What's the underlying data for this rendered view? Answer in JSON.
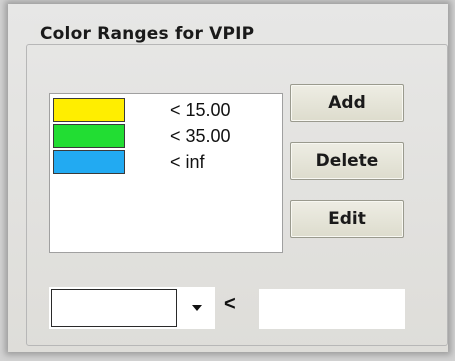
{
  "groupbox": {
    "title": "Color Ranges for VPIP"
  },
  "ranges": [
    {
      "color": "#ffee00",
      "label": "< 15.00"
    },
    {
      "color": "#22dd33",
      "label": "< 35.00"
    },
    {
      "color": "#22aaf2",
      "label": "< inf"
    }
  ],
  "buttons": {
    "add": "Add",
    "delete": "Delete",
    "edit": "Edit"
  },
  "editor": {
    "color_value": "",
    "operator": "<",
    "value": "",
    "value_placeholder": ""
  }
}
